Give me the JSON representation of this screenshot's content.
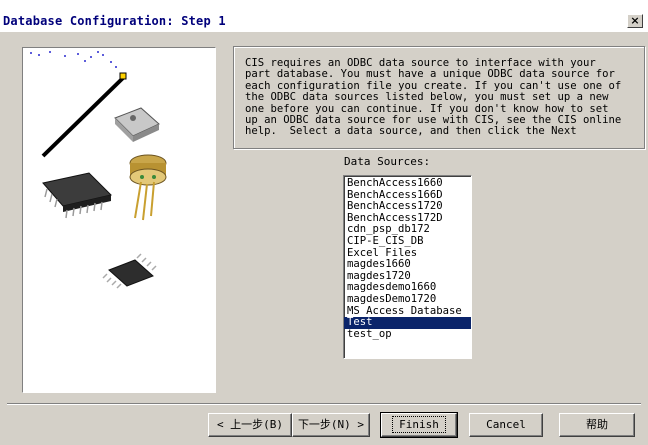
{
  "window": {
    "title": "Database Configuration: Step 1",
    "close_glyph": "×"
  },
  "info_text": "CIS requires an ODBC data source to interface with your\npart database. You must have a unique ODBC data source for\neach configuration file you create. If you can't use one of\nthe ODBC data sources listed below, you must set up a new\none before you can continue. If you don't know how to set\nup an ODBC data source for use with CIS, see the CIS online\nhelp.  Select a data source, and then click the Next",
  "data_sources": {
    "label": "Data Sources:",
    "items": [
      "BenchAccess1660",
      "BenchAccess166D",
      "BenchAccess1720",
      "BenchAccess172D",
      "cdn_psp_db172",
      "CIP-E_CIS_DB",
      "Excel Files",
      "magdes1660",
      "magdes1720",
      "magdesdemo1660",
      "magdesDemo1720",
      "MS Access Database",
      "Test",
      "test_op"
    ],
    "selected": "Test"
  },
  "buttons": {
    "back": "< 上一步(B)",
    "next": "下一步(N) >",
    "finish": "Finish",
    "cancel": "Cancel",
    "help": "帮助"
  },
  "colors": {
    "selection": "#0a246a",
    "title_text": "#00007b",
    "face": "#d4d0c8"
  },
  "icons": [
    "close-icon",
    "electronic-components-illustration"
  ]
}
